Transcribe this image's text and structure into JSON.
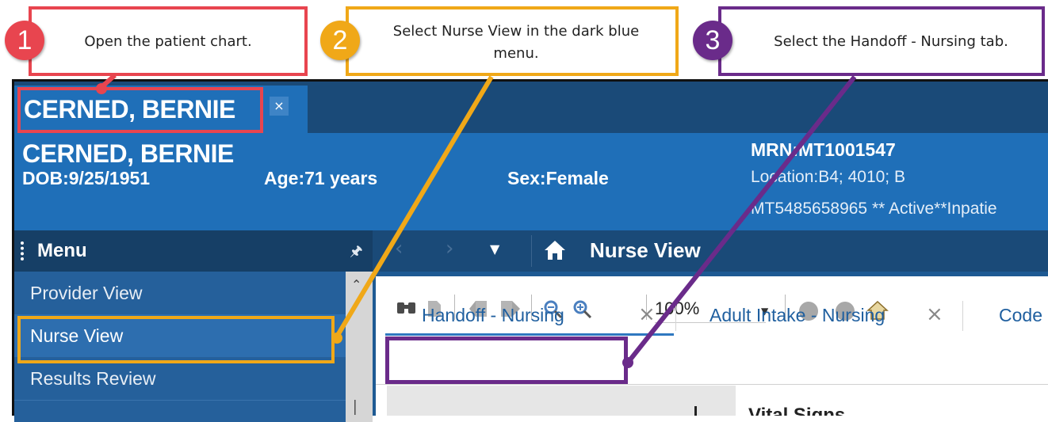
{
  "callouts": [
    {
      "number": "1",
      "text": "Open the patient chart.",
      "color": "#e8454f"
    },
    {
      "number": "2",
      "text": "Select Nurse View in the dark blue menu.",
      "color": "#f0a818"
    },
    {
      "number": "3",
      "text": "Select the Handoff - Nursing tab.",
      "color": "#6a2b8a"
    }
  ],
  "chart_tab": {
    "label": "CERNED, BERNIE",
    "close": "×"
  },
  "banner": {
    "name": "CERNED, BERNIE",
    "dob": "DOB:9/25/1951",
    "age": "Age:71 years",
    "sex": "Sex:Female",
    "mrn": "MRN:MT1001547",
    "location": "Location:B4; 4010; B",
    "encounter": "MT5485658965 ** Active**Inpatie"
  },
  "menu": {
    "title": "Menu",
    "items": [
      {
        "label": "Provider View"
      },
      {
        "label": "Nurse View"
      },
      {
        "label": "Results Review"
      }
    ]
  },
  "nav": {
    "title": "Nurse View"
  },
  "toolbar": {
    "zoom": "100%"
  },
  "tabs": [
    {
      "label": "Handoff - Nursing"
    },
    {
      "label": "Adult Intake - Nursing"
    },
    {
      "label": "Code"
    }
  ],
  "section": {
    "label": "Vital Signs"
  }
}
